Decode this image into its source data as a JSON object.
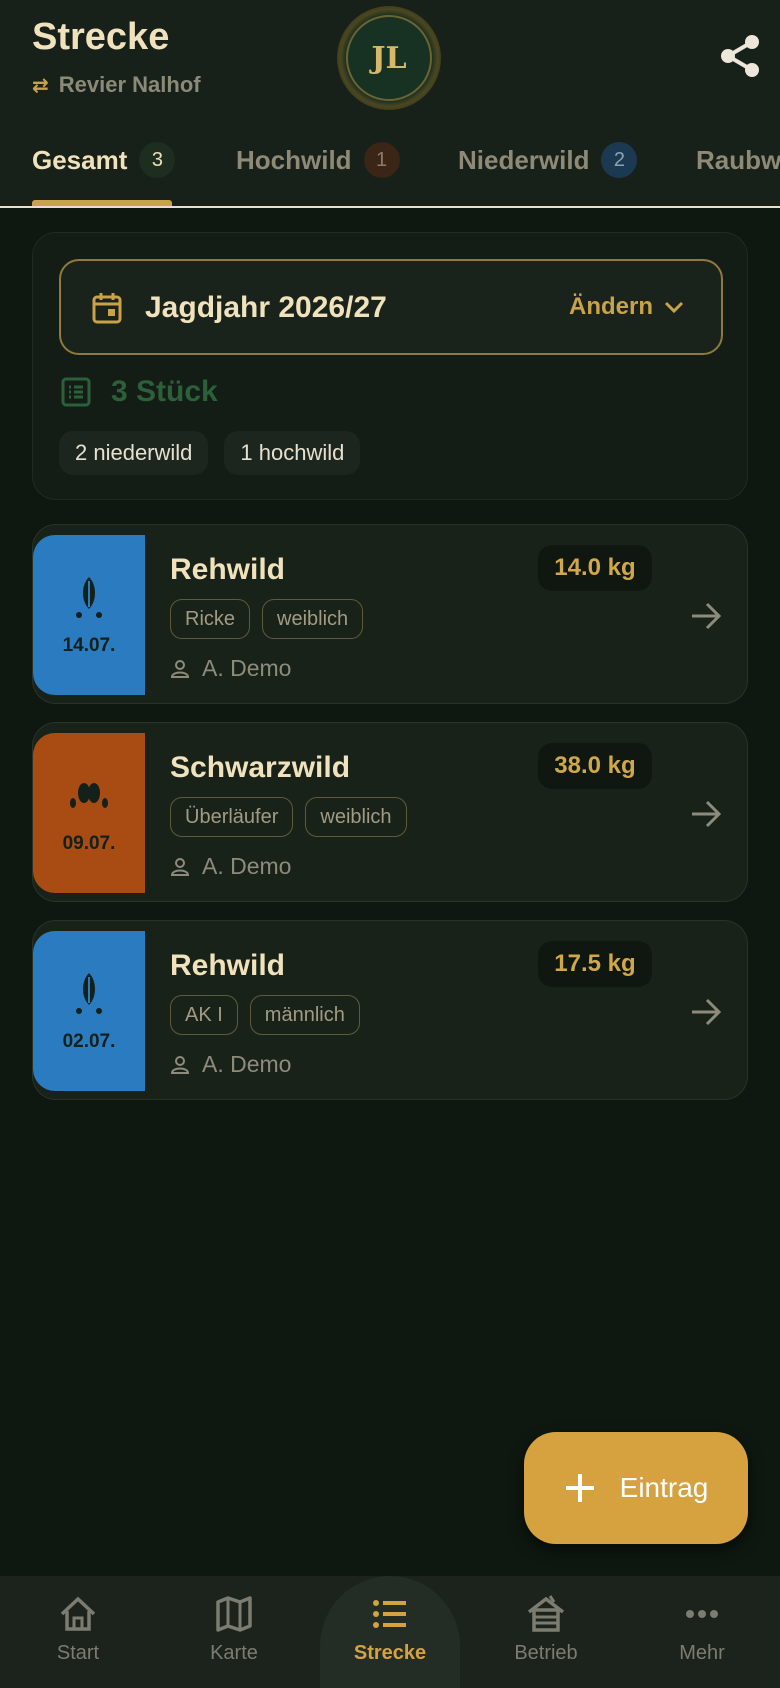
{
  "header": {
    "title": "Strecke",
    "subtitle": "Revier Nalhof",
    "logo_text": "JL"
  },
  "tabs": [
    {
      "label": "Gesamt",
      "count": "3",
      "active": true
    },
    {
      "label": "Hochwild",
      "count": "1"
    },
    {
      "label": "Niederwild",
      "count": "2"
    },
    {
      "label": "Raubwild"
    }
  ],
  "summary": {
    "year_label": "Jagdjahr 2026/27",
    "change_label": "Ändern",
    "count_label": "3 Stück",
    "chips": [
      "2 niederwild",
      "1 hochwild"
    ]
  },
  "entries": [
    {
      "date": "14.07.",
      "name": "Rehwild",
      "weight": "14.0 kg",
      "tags": [
        "Ricke",
        "weiblich"
      ],
      "hunter": "A. Demo",
      "color": "#2a7bbf",
      "icon": "roe-deer-track-icon"
    },
    {
      "date": "09.07.",
      "name": "Schwarzwild",
      "weight": "38.0 kg",
      "tags": [
        "Überläufer",
        "weiblich"
      ],
      "hunter": "A. Demo",
      "color": "#a84c14",
      "icon": "boar-track-icon"
    },
    {
      "date": "02.07.",
      "name": "Rehwild",
      "weight": "17.5 kg",
      "tags": [
        "AK I",
        "männlich"
      ],
      "hunter": "A. Demo",
      "color": "#2a7bbf",
      "icon": "roe-deer-track-icon"
    }
  ],
  "fab": {
    "label": "Eintrag"
  },
  "bottom_nav": [
    {
      "label": "Start",
      "icon": "home-icon"
    },
    {
      "label": "Karte",
      "icon": "map-icon"
    },
    {
      "label": "Strecke",
      "icon": "list-icon",
      "active": true
    },
    {
      "label": "Betrieb",
      "icon": "hut-icon"
    },
    {
      "label": "Mehr",
      "icon": "more-icon"
    }
  ],
  "colors": {
    "accent": "#c9a24a",
    "background": "#0e1710",
    "hochwild": "#2a7bbf",
    "niederwild": "#a84c14"
  }
}
